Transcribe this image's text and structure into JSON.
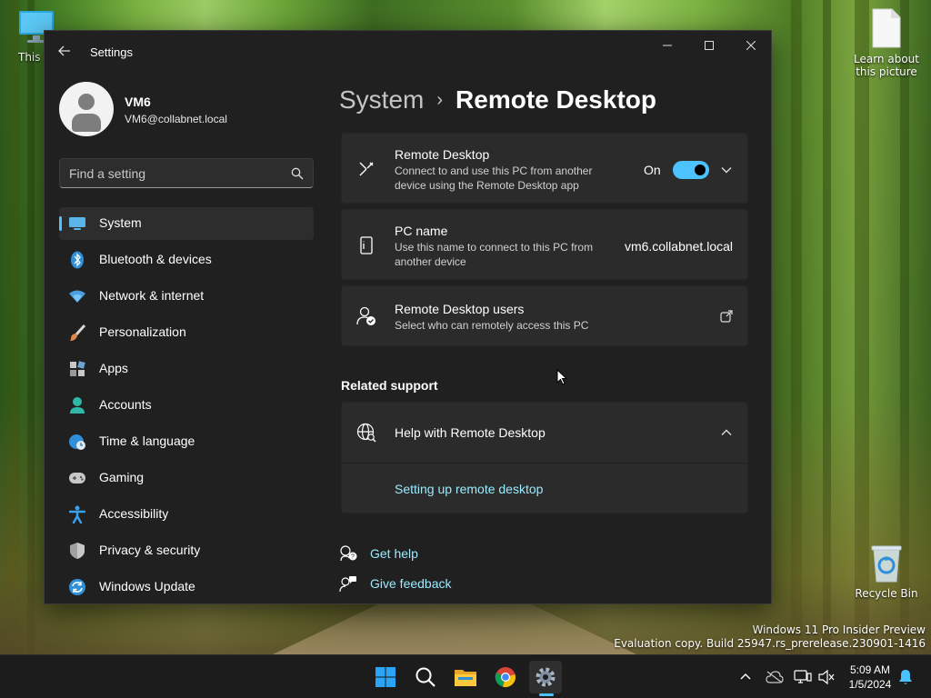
{
  "desktop": {
    "icons": [
      {
        "label": "This PC"
      },
      {
        "label": "Learn about this picture"
      },
      {
        "label": "Recycle Bin"
      }
    ],
    "watermark": {
      "line1": "Windows 11 Pro Insider Preview",
      "line2": "Evaluation copy. Build 25947.rs_prerelease.230901-1416"
    }
  },
  "window": {
    "title": "Settings",
    "controls": {
      "minimize": "—",
      "maximize": "☐",
      "close": "✕"
    }
  },
  "profile": {
    "name": "VM6",
    "email": "VM6@collabnet.local"
  },
  "search": {
    "placeholder": "Find a setting"
  },
  "sidebar": {
    "items": [
      {
        "label": "System",
        "icon": "monitor-icon",
        "active": true
      },
      {
        "label": "Bluetooth & devices",
        "icon": "bluetooth-icon"
      },
      {
        "label": "Network & internet",
        "icon": "wifi-icon"
      },
      {
        "label": "Personalization",
        "icon": "brush-icon"
      },
      {
        "label": "Apps",
        "icon": "apps-icon"
      },
      {
        "label": "Accounts",
        "icon": "person-icon"
      },
      {
        "label": "Time & language",
        "icon": "globe-clock-icon"
      },
      {
        "label": "Gaming",
        "icon": "gamepad-icon"
      },
      {
        "label": "Accessibility",
        "icon": "accessibility-icon"
      },
      {
        "label": "Privacy & security",
        "icon": "shield-icon"
      },
      {
        "label": "Windows Update",
        "icon": "update-icon"
      }
    ]
  },
  "breadcrumb": {
    "parent": "System",
    "separator": "›",
    "current": "Remote Desktop"
  },
  "cards": {
    "remote_desktop": {
      "title": "Remote Desktop",
      "description": "Connect to and use this PC from another device using the Remote Desktop app",
      "toggle_label": "On",
      "toggle_on": true
    },
    "pc_name": {
      "title": "PC name",
      "description": "Use this name to connect to this PC from another device",
      "value": "vm6.collabnet.local"
    },
    "rd_users": {
      "title": "Remote Desktop users",
      "description": "Select who can remotely access this PC"
    }
  },
  "related_support": {
    "title": "Related support",
    "help": {
      "title": "Help with Remote Desktop",
      "expanded": true,
      "link": "Setting up remote desktop"
    }
  },
  "footer_links": {
    "get_help": "Get help",
    "give_feedback": "Give feedback"
  },
  "taskbar": {
    "apps": [
      "start-icon",
      "search-icon",
      "file-explorer-icon",
      "chrome-icon",
      "settings-icon"
    ],
    "active_app": "settings-icon",
    "clock": {
      "time": "5:09 AM",
      "date": "1/5/2024"
    }
  },
  "colors": {
    "accent": "#4cc2ff",
    "link": "#99ebff",
    "window_bg": "#202020",
    "card_bg": "#2b2b2b"
  }
}
